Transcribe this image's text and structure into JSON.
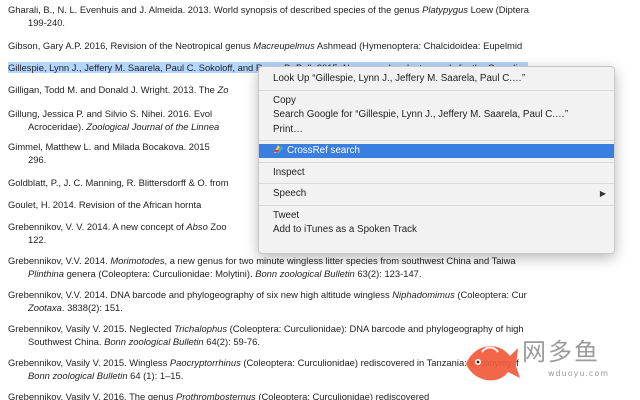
{
  "references": [
    {
      "lines": [
        {
          "parts": [
            {
              "t": "Gharali, B., N. L. Evenhuis and J. Almeida. 2013. World synopsis of described species of the genus "
            },
            {
              "t": "Platypygus",
              "i": true
            },
            {
              "t": " Loew (Diptera"
            }
          ]
        },
        {
          "parts": [
            {
              "t": "199-240."
            }
          ]
        }
      ]
    },
    {
      "lines": [
        {
          "parts": [
            {
              "t": "Gibson, Gary A.P. 2016, Revision of the Neotropical genus "
            },
            {
              "t": "Macreupelmus",
              "i": true
            },
            {
              "t": " Ashmead (Hymenoptera: Chalcidoidea: Eupelmid"
            }
          ]
        }
      ]
    },
    {
      "selected": true,
      "lines": [
        {
          "parts": [
            {
              "t": "Gillespie, Lynn J., Jeffery M. Saarela, Paul C. Sokoloff, and Roger D. Bull. 2015. New vascular plant records for the Canadian"
            }
          ]
        }
      ]
    },
    {
      "lines": [
        {
          "parts": [
            {
              "t": "Gilligan, Todd M. and Donald J. Wright. 2013. The "
            },
            {
              "t": "Zo",
              "i": true
            }
          ]
        }
      ]
    },
    {
      "lines": [
        {
          "parts": [
            {
              "t": "Gillung, Jessica P. and Silvio S. Nihei. 2016. Evol"
            }
          ]
        },
        {
          "parts": [
            {
              "t": "Acroceridae). "
            },
            {
              "t": "Zoological Journal of the Linnea",
              "i": true
            }
          ]
        }
      ]
    },
    {
      "lines": [
        {
          "parts": [
            {
              "t": "Gimmel, Matthew L. and Milada Bocakova. 2015"
            }
          ]
        },
        {
          "parts": [
            {
              "t": "296."
            }
          ]
        }
      ]
    },
    {
      "lines": [
        {
          "parts": [
            {
              "t": "Goldblatt, P., J. C. Manning, R. Blittersdorff & O."
            },
            {
              "t": "  from"
            }
          ]
        }
      ]
    },
    {
      "lines": [
        {
          "parts": [
            {
              "t": "Goulet, H. 2014. Revision of the African hornta"
            }
          ]
        }
      ]
    },
    {
      "lines": [
        {
          "parts": [
            {
              "t": "Grebennikov, V. V. 2014. A new concept of "
            },
            {
              "t": "Abso",
              "i": true
            },
            {
              "t": "  Zoo"
            }
          ]
        },
        {
          "parts": [
            {
              "t": "122."
            }
          ]
        }
      ]
    },
    {
      "lines": [
        {
          "parts": [
            {
              "t": "Grebennikov, V.V. 2014. "
            },
            {
              "t": "Morimotodes",
              "i": true
            },
            {
              "t": ", a new genus for two minute wingless litter species from southwest China and Taiwa"
            }
          ]
        },
        {
          "parts": [
            {
              "t": "Plinthina",
              "i": true
            },
            {
              "t": " genera (Coleoptera: Curculionidae: Molytini). "
            },
            {
              "t": "Bonn zoological Bulletin",
              "i": true
            },
            {
              "t": " 63(2): 123-147."
            }
          ]
        }
      ]
    },
    {
      "lines": [
        {
          "parts": [
            {
              "t": "Grebennikov, V.V. 2014. DNA barcode and phylogeography of six new high altitude wingless "
            },
            {
              "t": "Niphadomimus",
              "i": true
            },
            {
              "t": " (Coleoptera: Cur"
            }
          ]
        },
        {
          "parts": [
            {
              "t": "Zootaxa",
              "i": true
            },
            {
              "t": ". 3838(2): 151."
            }
          ]
        }
      ]
    },
    {
      "lines": [
        {
          "parts": [
            {
              "t": "Grebennikov, Vasily V. 2015. Neglected "
            },
            {
              "t": "Trichalophus",
              "i": true
            },
            {
              "t": " (Coleoptera: Curculionidae): DNA barcode and phylogeography of high"
            }
          ]
        },
        {
          "parts": [
            {
              "t": "Southwest China. "
            },
            {
              "t": "Bonn zoological Bulletin",
              "i": true
            },
            {
              "t": " 64(2): 59-76."
            }
          ]
        }
      ]
    },
    {
      "lines": [
        {
          "parts": [
            {
              "t": "Grebennikov, Vasily V. 2015. Wingless "
            },
            {
              "t": "Paocryptorrhinus",
              "i": true
            },
            {
              "t": " (Coleoptera: Curculionidae) rediscovered in Tanzania: synonymy, f"
            }
          ]
        },
        {
          "parts": [
            {
              "t": "Bonn zoological Bulletin",
              "i": true
            },
            {
              "t": " 64 (1): 1–15."
            }
          ]
        }
      ]
    },
    {
      "lines": [
        {
          "parts": [
            {
              "t": "Grebennikov, Vasily V. 2016. The genus "
            },
            {
              "t": "Prothrombosternus",
              "i": true
            },
            {
              "t": " (Coleoptera: Curculionidae) rediscovered"
            }
          ]
        }
      ]
    }
  ],
  "context_menu": {
    "items": [
      {
        "label": "Look Up “Gillespie, Lynn J., Jeffery M. Saarela, Paul C.…”",
        "name": "menu-item-look-up"
      },
      {
        "sep": true
      },
      {
        "label": "Copy",
        "name": "menu-item-copy"
      },
      {
        "label": "Search Google for “Gillespie, Lynn J., Jeffery M. Saarela, Paul C.…”",
        "name": "menu-item-search-google"
      },
      {
        "label": "Print…",
        "name": "menu-item-print"
      },
      {
        "sep": true
      },
      {
        "label": "CrossRef search",
        "name": "menu-item-crossref-search",
        "highlight": true,
        "icon": "crossref-icon"
      },
      {
        "sep": true
      },
      {
        "label": "Inspect",
        "name": "menu-item-inspect"
      },
      {
        "sep": true
      },
      {
        "label": "Speech",
        "name": "menu-item-speech",
        "submenu": true
      },
      {
        "sep": true
      },
      {
        "label": "Tweet",
        "name": "menu-item-tweet"
      },
      {
        "label": "Add to iTunes as a Spoken Track",
        "name": "menu-item-add-to-itunes"
      }
    ],
    "colors": {
      "highlight": "#3a7ee0",
      "selection": "#b4d5fe"
    }
  },
  "watermark": {
    "text": "网多鱼",
    "url": "wduoyu.com",
    "icon": "fish-icon"
  }
}
